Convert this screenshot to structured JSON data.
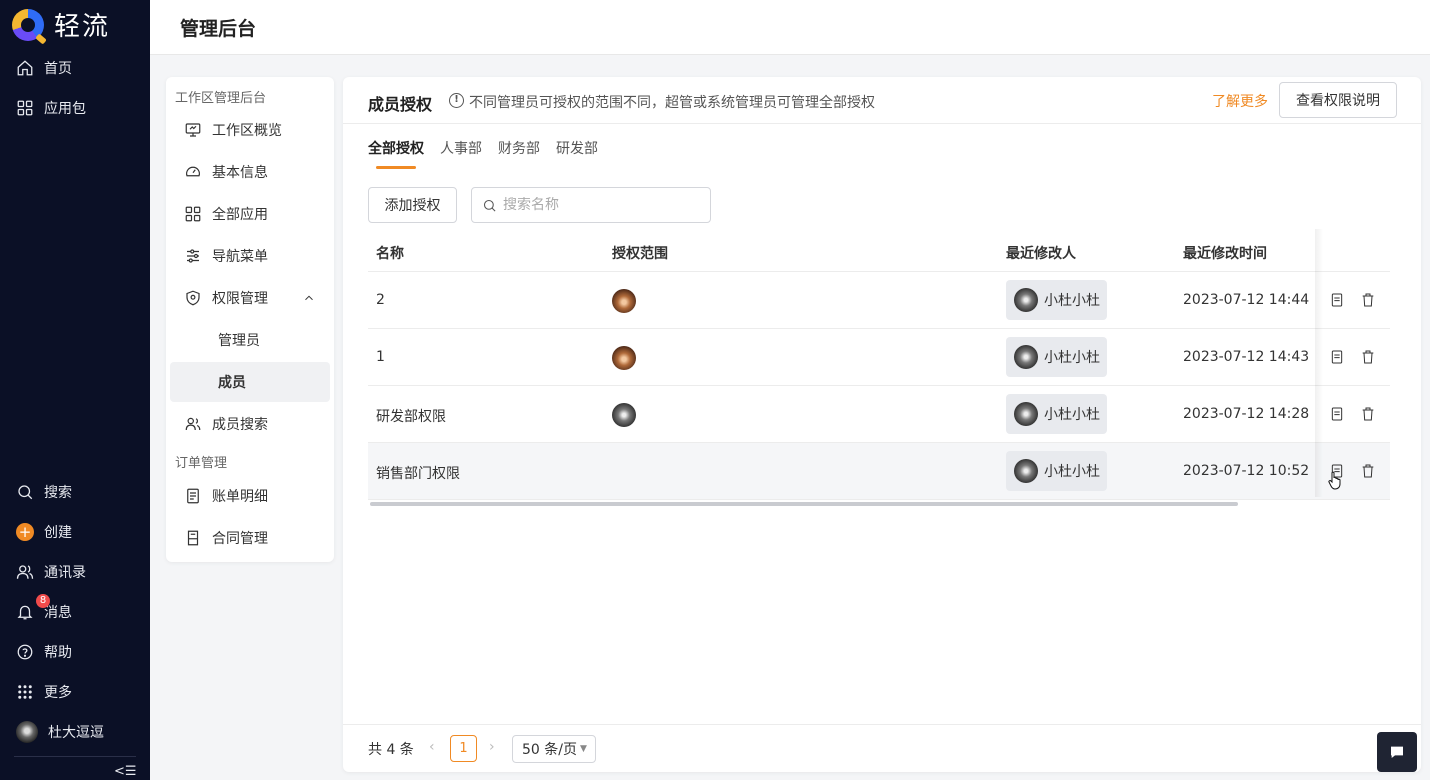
{
  "brand": {
    "name": "轻流"
  },
  "nav": {
    "top_items": [
      {
        "label": "首页",
        "icon": "home-icon"
      },
      {
        "label": "应用包",
        "icon": "grid-icon"
      }
    ],
    "bottom_items": [
      {
        "label": "搜索",
        "icon": "search-icon"
      },
      {
        "label": "创建",
        "icon": "plus-icon"
      },
      {
        "label": "通讯录",
        "icon": "contacts-icon"
      },
      {
        "label": "消息",
        "icon": "bell-icon",
        "badge": "8"
      },
      {
        "label": "帮助",
        "icon": "help-icon"
      },
      {
        "label": "更多",
        "icon": "dots-grid-icon"
      }
    ],
    "user_name": "杜大逗逗",
    "collapse_glyph": "<☰"
  },
  "header": {
    "title": "管理后台"
  },
  "sidebar": {
    "group1": "工作区管理后台",
    "items": [
      {
        "label": "工作区概览",
        "icon": "monitor-icon"
      },
      {
        "label": "基本信息",
        "icon": "gauge-icon"
      },
      {
        "label": "全部应用",
        "icon": "apps-icon"
      },
      {
        "label": "导航菜单",
        "icon": "sliders-icon"
      },
      {
        "label": "权限管理",
        "icon": "shield-icon"
      }
    ],
    "sub_items": [
      {
        "label": "管理员"
      },
      {
        "label": "成员"
      }
    ],
    "member_search": "成员搜索",
    "group2": "订单管理",
    "order_items": [
      {
        "label": "账单明细"
      },
      {
        "label": "合同管理"
      }
    ]
  },
  "main": {
    "title": "成员授权",
    "info_glyph": "!",
    "description": "不同管理员可授权的范围不同，超管或系统管理员可管理全部授权",
    "learn_more": "了解更多",
    "view_permissions": "查看权限说明",
    "tabs": [
      "全部授权",
      "人事部",
      "财务部",
      "研发部"
    ],
    "add_button": "添加授权",
    "search": {
      "placeholder": "搜索名称",
      "value": ""
    },
    "columns": [
      "名称",
      "授权范围",
      "最近修改人",
      "最近修改时间"
    ],
    "rows": [
      {
        "name": "2",
        "modifier": "小杜小杜",
        "time": "2023-07-12 14:44"
      },
      {
        "name": "1",
        "modifier": "小杜小杜",
        "time": "2023-07-12 14:43"
      },
      {
        "name": "研发部权限",
        "modifier": "小杜小杜",
        "time": "2023-07-12 14:28"
      },
      {
        "name": "销售部门权限",
        "modifier": "小杜小杜",
        "time": "2023-07-12 10:52"
      }
    ],
    "pagination": {
      "total": "共 4 条",
      "prev": "‹",
      "current": "1",
      "next": "›",
      "page_size": "50 条/页"
    }
  },
  "colors": {
    "accent": "#f08a24",
    "nav_bg": "#0b1026"
  }
}
